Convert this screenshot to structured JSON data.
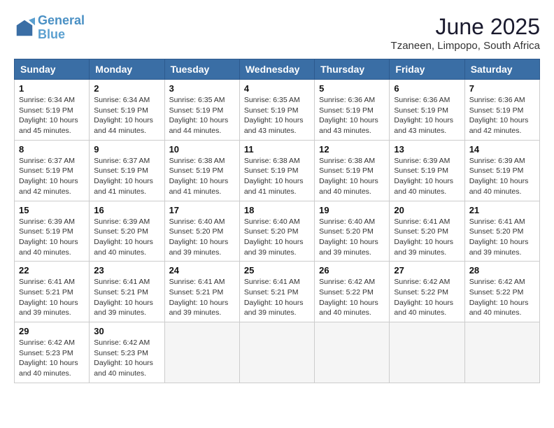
{
  "header": {
    "logo_line1": "General",
    "logo_line2": "Blue",
    "month_title": "June 2025",
    "location": "Tzaneen, Limpopo, South Africa"
  },
  "weekdays": [
    "Sunday",
    "Monday",
    "Tuesday",
    "Wednesday",
    "Thursday",
    "Friday",
    "Saturday"
  ],
  "weeks": [
    [
      {
        "day": "1",
        "sunrise": "6:34 AM",
        "sunset": "5:19 PM",
        "daylight": "10 hours and 45 minutes."
      },
      {
        "day": "2",
        "sunrise": "6:34 AM",
        "sunset": "5:19 PM",
        "daylight": "10 hours and 44 minutes."
      },
      {
        "day": "3",
        "sunrise": "6:35 AM",
        "sunset": "5:19 PM",
        "daylight": "10 hours and 44 minutes."
      },
      {
        "day": "4",
        "sunrise": "6:35 AM",
        "sunset": "5:19 PM",
        "daylight": "10 hours and 43 minutes."
      },
      {
        "day": "5",
        "sunrise": "6:36 AM",
        "sunset": "5:19 PM",
        "daylight": "10 hours and 43 minutes."
      },
      {
        "day": "6",
        "sunrise": "6:36 AM",
        "sunset": "5:19 PM",
        "daylight": "10 hours and 43 minutes."
      },
      {
        "day": "7",
        "sunrise": "6:36 AM",
        "sunset": "5:19 PM",
        "daylight": "10 hours and 42 minutes."
      }
    ],
    [
      {
        "day": "8",
        "sunrise": "6:37 AM",
        "sunset": "5:19 PM",
        "daylight": "10 hours and 42 minutes."
      },
      {
        "day": "9",
        "sunrise": "6:37 AM",
        "sunset": "5:19 PM",
        "daylight": "10 hours and 41 minutes."
      },
      {
        "day": "10",
        "sunrise": "6:38 AM",
        "sunset": "5:19 PM",
        "daylight": "10 hours and 41 minutes."
      },
      {
        "day": "11",
        "sunrise": "6:38 AM",
        "sunset": "5:19 PM",
        "daylight": "10 hours and 41 minutes."
      },
      {
        "day": "12",
        "sunrise": "6:38 AM",
        "sunset": "5:19 PM",
        "daylight": "10 hours and 40 minutes."
      },
      {
        "day": "13",
        "sunrise": "6:39 AM",
        "sunset": "5:19 PM",
        "daylight": "10 hours and 40 minutes."
      },
      {
        "day": "14",
        "sunrise": "6:39 AM",
        "sunset": "5:19 PM",
        "daylight": "10 hours and 40 minutes."
      }
    ],
    [
      {
        "day": "15",
        "sunrise": "6:39 AM",
        "sunset": "5:19 PM",
        "daylight": "10 hours and 40 minutes."
      },
      {
        "day": "16",
        "sunrise": "6:39 AM",
        "sunset": "5:20 PM",
        "daylight": "10 hours and 40 minutes."
      },
      {
        "day": "17",
        "sunrise": "6:40 AM",
        "sunset": "5:20 PM",
        "daylight": "10 hours and 39 minutes."
      },
      {
        "day": "18",
        "sunrise": "6:40 AM",
        "sunset": "5:20 PM",
        "daylight": "10 hours and 39 minutes."
      },
      {
        "day": "19",
        "sunrise": "6:40 AM",
        "sunset": "5:20 PM",
        "daylight": "10 hours and 39 minutes."
      },
      {
        "day": "20",
        "sunrise": "6:41 AM",
        "sunset": "5:20 PM",
        "daylight": "10 hours and 39 minutes."
      },
      {
        "day": "21",
        "sunrise": "6:41 AM",
        "sunset": "5:20 PM",
        "daylight": "10 hours and 39 minutes."
      }
    ],
    [
      {
        "day": "22",
        "sunrise": "6:41 AM",
        "sunset": "5:21 PM",
        "daylight": "10 hours and 39 minutes."
      },
      {
        "day": "23",
        "sunrise": "6:41 AM",
        "sunset": "5:21 PM",
        "daylight": "10 hours and 39 minutes."
      },
      {
        "day": "24",
        "sunrise": "6:41 AM",
        "sunset": "5:21 PM",
        "daylight": "10 hours and 39 minutes."
      },
      {
        "day": "25",
        "sunrise": "6:41 AM",
        "sunset": "5:21 PM",
        "daylight": "10 hours and 39 minutes."
      },
      {
        "day": "26",
        "sunrise": "6:42 AM",
        "sunset": "5:22 PM",
        "daylight": "10 hours and 40 minutes."
      },
      {
        "day": "27",
        "sunrise": "6:42 AM",
        "sunset": "5:22 PM",
        "daylight": "10 hours and 40 minutes."
      },
      {
        "day": "28",
        "sunrise": "6:42 AM",
        "sunset": "5:22 PM",
        "daylight": "10 hours and 40 minutes."
      }
    ],
    [
      {
        "day": "29",
        "sunrise": "6:42 AM",
        "sunset": "5:23 PM",
        "daylight": "10 hours and 40 minutes."
      },
      {
        "day": "30",
        "sunrise": "6:42 AM",
        "sunset": "5:23 PM",
        "daylight": "10 hours and 40 minutes."
      },
      null,
      null,
      null,
      null,
      null
    ]
  ],
  "labels": {
    "sunrise_prefix": "Sunrise: ",
    "sunset_prefix": "Sunset: ",
    "daylight_label": "Daylight: "
  }
}
